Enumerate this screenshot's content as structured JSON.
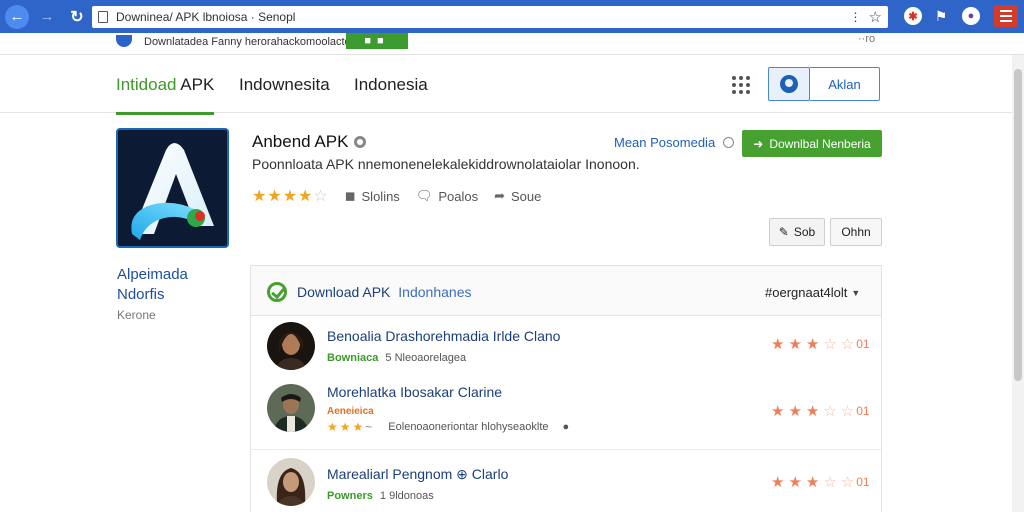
{
  "browser": {
    "url": "Downinea/ APK lbnoiosa · Senopl",
    "menu_label": "menu"
  },
  "strip": {
    "text": "Downlatadea  Fanny  herorahackomoolacte",
    "corner": "··ro"
  },
  "header": {
    "tabs": [
      {
        "prefix": "Intidoad",
        "label": "APK"
      },
      {
        "label": "Indownesita"
      },
      {
        "label": "Indonesia"
      }
    ],
    "signin_label": "Aklan"
  },
  "app": {
    "title": "Anbend APK",
    "description": "Poonnloata  APK  nnemonenelekalekiddrownolataiolar  Inonoon.",
    "rating": 3.5,
    "meta": [
      {
        "icon": "users-icon",
        "label": "Slolins"
      },
      {
        "icon": "comment-icon",
        "label": "Poalos"
      },
      {
        "icon": "share-icon",
        "label": "Soue"
      }
    ],
    "more_link": "Mean Posomedia",
    "download_label": "Downlbal Nenberia",
    "share_label": "Sob",
    "other_label": "Ohhn"
  },
  "sidebar": {
    "line1": "Alpeimada",
    "line2": "Ndorfis",
    "line3": "Kerone"
  },
  "panel": {
    "title": "Download APK",
    "subtitle": "Indonhanes",
    "sort_label": "#oergnaat4lolt",
    "reviews": [
      {
        "name": "Benoalia Drashorehmadia Irlde Clano",
        "tag": "Bowniaca",
        "meta": "5 Nleoaorelagea",
        "stars": "★★★☆☆",
        "count": "01"
      },
      {
        "name": "Morehlatka Ibosakar Clarine",
        "tag": "Aeneieica",
        "meta": "Eolenoaoneriontar hlohyseaoklte",
        "stars": "★★★☆☆",
        "count": "01"
      },
      {
        "name": "Marealiarl Pengnom ⊕ Clarlo",
        "tag": "Powners",
        "meta": "1 9ldonoas",
        "stars": "★★★☆☆",
        "count": "01"
      }
    ]
  }
}
